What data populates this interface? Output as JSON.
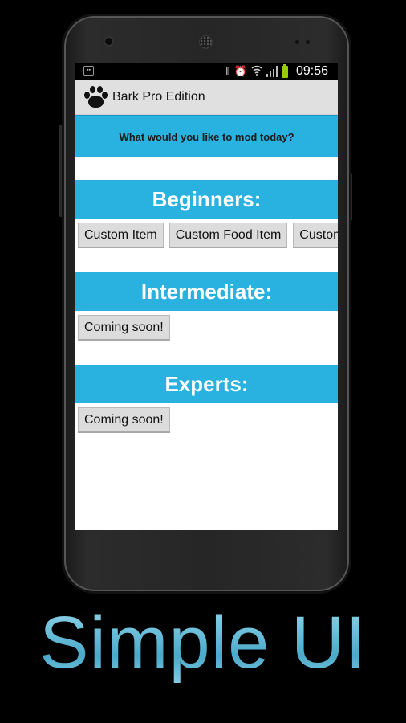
{
  "status_bar": {
    "time": "09:56",
    "icons": [
      "notification-icon",
      "vibrate-icon",
      "alarm-icon",
      "wifi-icon",
      "signal-icon",
      "battery-icon"
    ]
  },
  "action_bar": {
    "title": "Bark Pro Edition",
    "icon": "paw-icon"
  },
  "prompt": "What would you like to mod today?",
  "sections": [
    {
      "title": "Beginners:",
      "buttons": [
        "Custom Item",
        "Custom Food Item",
        "Custom Block"
      ]
    },
    {
      "title": "Intermediate:",
      "buttons": [
        "Coming soon!"
      ]
    },
    {
      "title": "Experts:",
      "buttons": [
        "Coming soon!"
      ]
    }
  ],
  "tagline": "Simple UI",
  "colors": {
    "accent": "#29b1df",
    "action_bar": "#e0e0e0",
    "button": "#dcdcdc",
    "battery": "#99cc00"
  }
}
